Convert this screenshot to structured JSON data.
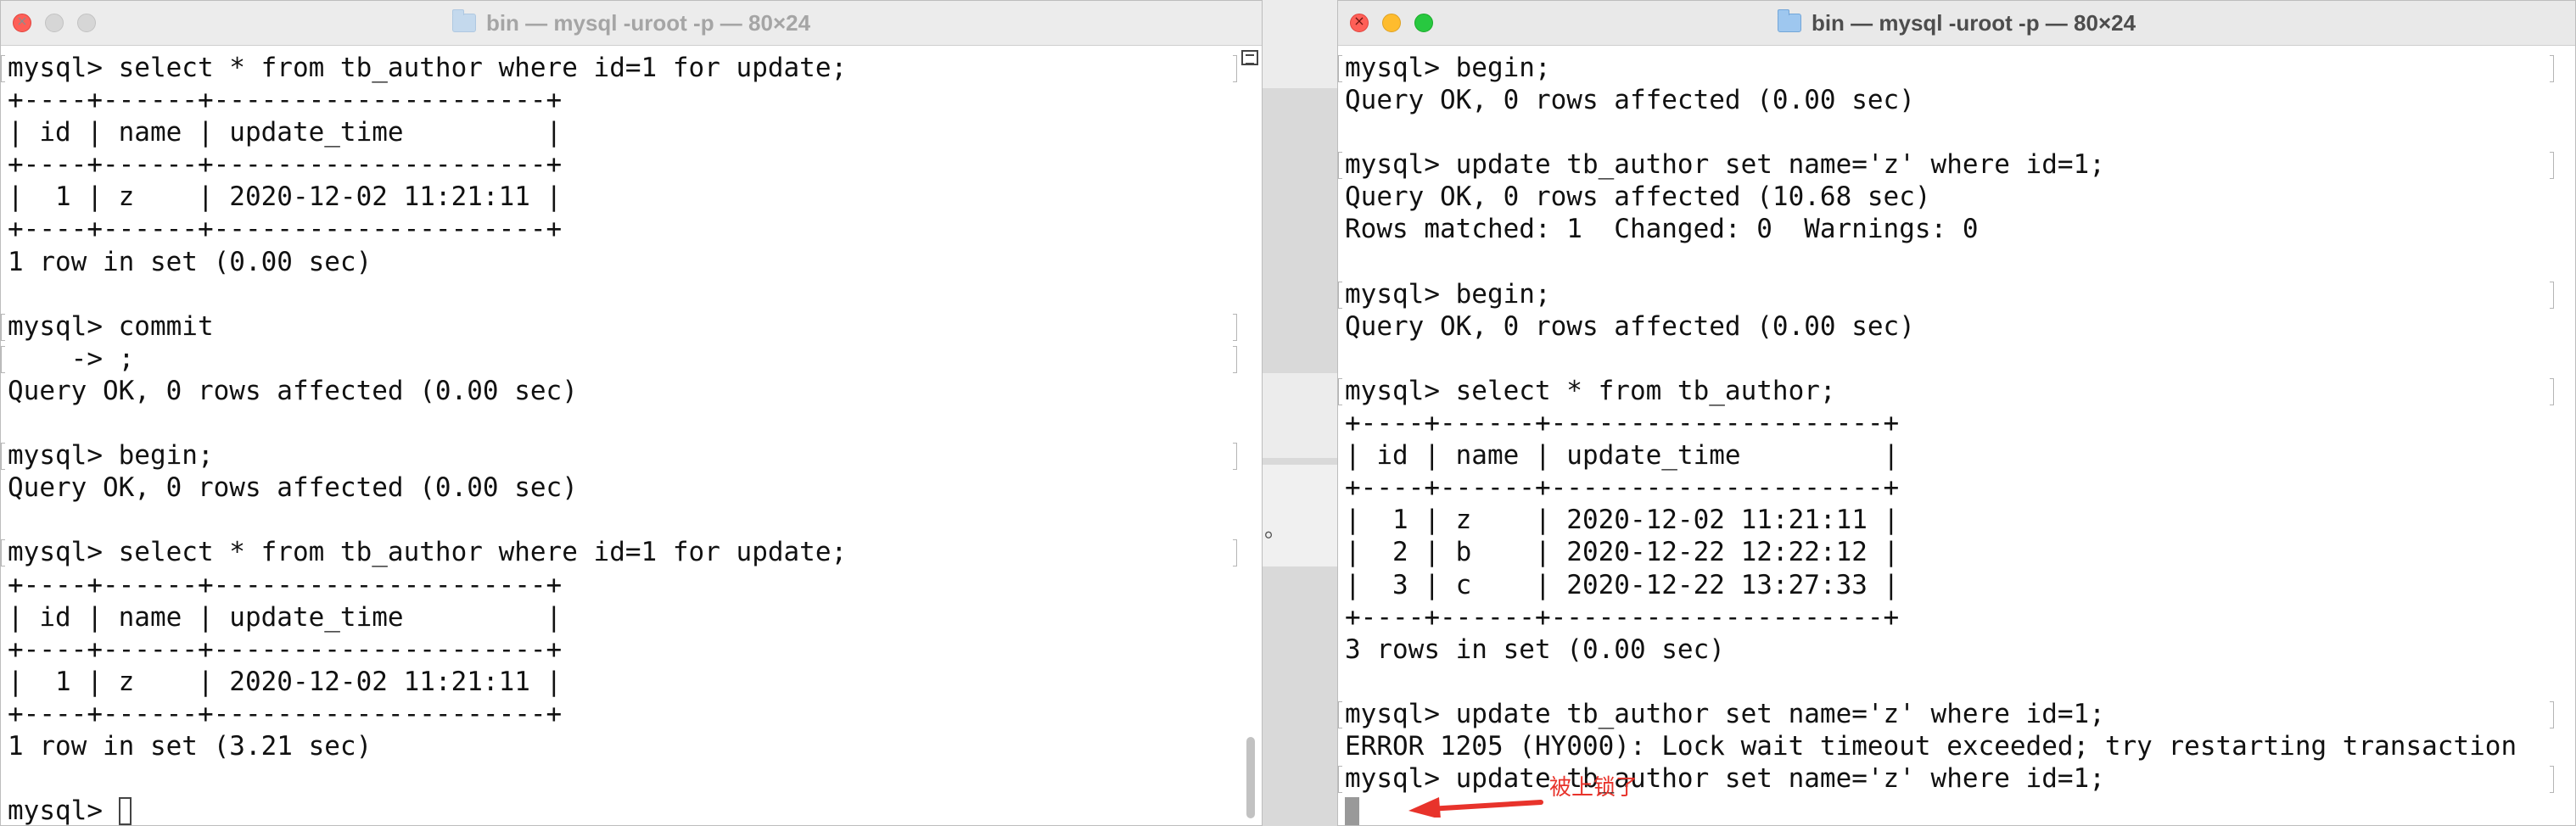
{
  "left_window": {
    "title": "bin — mysql -uroot -p — 80×24",
    "lines": [
      "mysql> select * from tb_author where id=1 for update;",
      "+----+------+---------------------+",
      "| id | name | update_time         |",
      "+----+------+---------------------+",
      "|  1 | z    | 2020-12-02 11:21:11 |",
      "+----+------+---------------------+",
      "1 row in set (0.00 sec)",
      "",
      "mysql> commit",
      "    -> ;",
      "Query OK, 0 rows affected (0.00 sec)",
      "",
      "mysql> begin;",
      "Query OK, 0 rows affected (0.00 sec)",
      "",
      "mysql> select * from tb_author where id=1 for update;",
      "+----+------+---------------------+",
      "| id | name | update_time         |",
      "+----+------+---------------------+",
      "|  1 | z    | 2020-12-02 11:21:11 |",
      "+----+------+---------------------+",
      "1 row in set (3.21 sec)",
      "",
      "mysql> "
    ]
  },
  "right_window": {
    "title": "bin — mysql -uroot -p — 80×24",
    "lines": [
      "mysql> begin;",
      "Query OK, 0 rows affected (0.00 sec)",
      "",
      "mysql> update tb_author set name='z' where id=1;",
      "Query OK, 0 rows affected (10.68 sec)",
      "Rows matched: 1  Changed: 0  Warnings: 0",
      "",
      "mysql> begin;",
      "Query OK, 0 rows affected (0.00 sec)",
      "",
      "mysql> select * from tb_author;",
      "+----+------+---------------------+",
      "| id | name | update_time         |",
      "+----+------+---------------------+",
      "|  1 | z    | 2020-12-02 11:21:11 |",
      "|  2 | b    | 2020-12-22 12:22:12 |",
      "|  3 | c    | 2020-12-22 13:27:33 |",
      "+----+------+---------------------+",
      "3 rows in set (0.00 sec)",
      "",
      "mysql> update tb_author set name='z' where id=1;",
      "ERROR 1205 (HY000): Lock wait timeout exceeded; try restarting transaction",
      "mysql> update tb_author set name='z' where id=1;",
      ""
    ]
  },
  "annotation": {
    "text": "被上锁了",
    "color": "#e8332b"
  },
  "background_fragment": "。",
  "icons": {
    "title_icon": "folder-icon",
    "traffic_lights": [
      "close-icon",
      "minimize-icon",
      "zoom-icon"
    ],
    "scroll_marker": "marks-icon"
  }
}
